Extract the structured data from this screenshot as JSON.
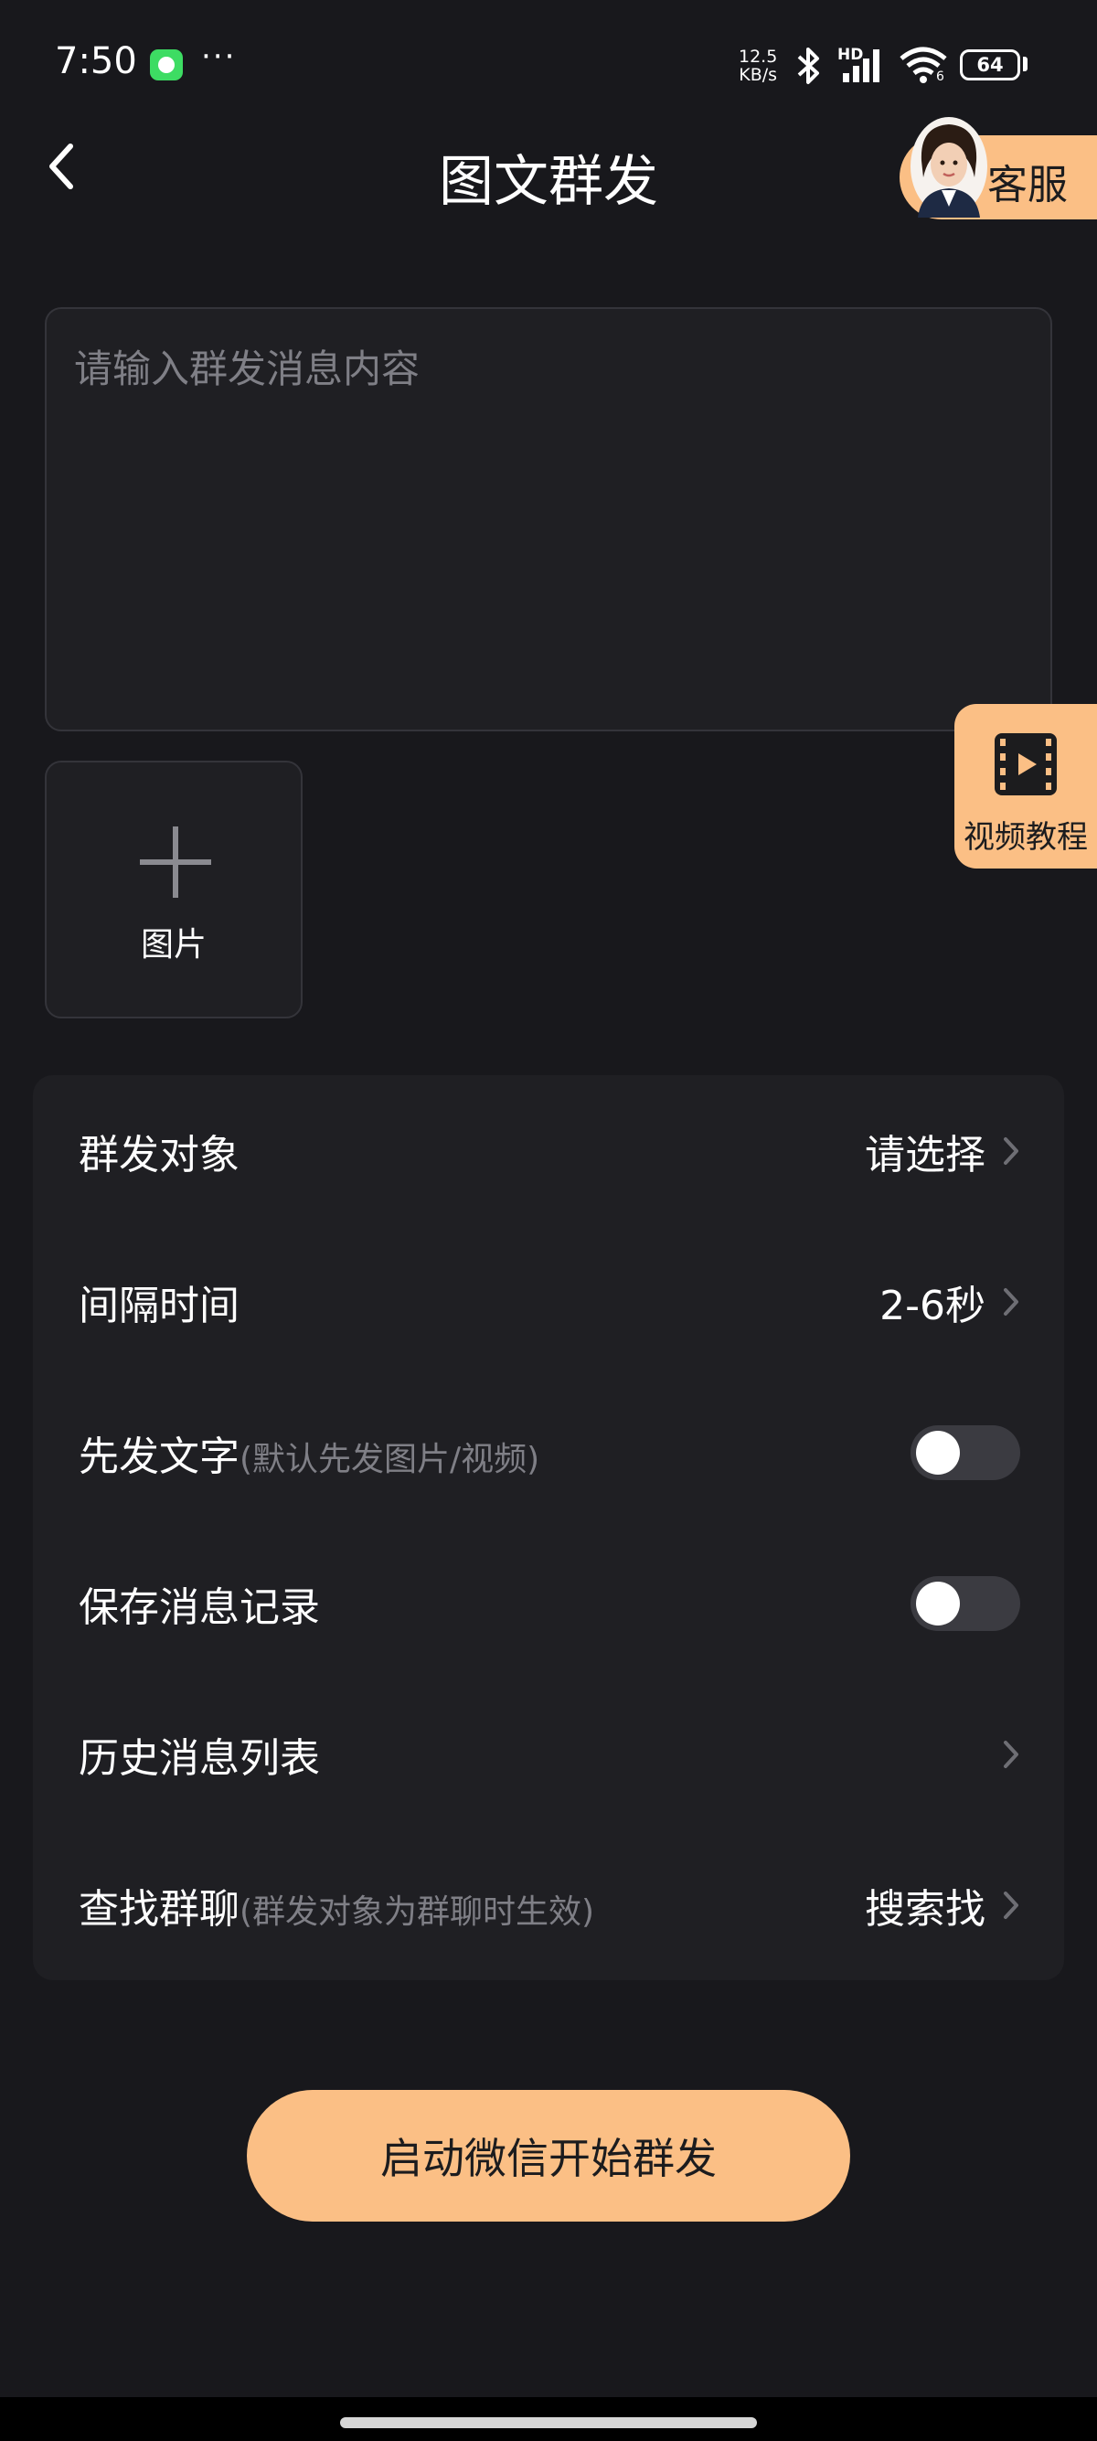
{
  "status_bar": {
    "time": "7:50",
    "more": "···",
    "net_speed_value": "12.5",
    "net_speed_unit": "KB/s",
    "hd_label": "HD",
    "wifi_sub": "6",
    "battery": "64"
  },
  "header": {
    "title": "图文群发",
    "service_label": "客服"
  },
  "message": {
    "placeholder": "请输入群发消息内容",
    "value": ""
  },
  "video_tutorial": {
    "label": "视频教程"
  },
  "add_image": {
    "label": "图片"
  },
  "settings": {
    "rows": [
      {
        "label": "群发对象",
        "hint": "",
        "value": "请选择",
        "control": "chevron"
      },
      {
        "label": "间隔时间",
        "hint": "",
        "value": "2-6秒",
        "control": "chevron"
      },
      {
        "label": "先发文字",
        "hint": "(默认先发图片/视频)",
        "value": "",
        "control": "toggle",
        "on": false
      },
      {
        "label": "保存消息记录",
        "hint": "",
        "value": "",
        "control": "toggle",
        "on": false
      },
      {
        "label": "历史消息列表",
        "hint": "",
        "value": "",
        "control": "chevron"
      },
      {
        "label": "查找群聊",
        "hint": "(群发对象为群聊时生效)",
        "value": "搜索找",
        "control": "chevron"
      }
    ]
  },
  "start_button": {
    "label": "启动微信开始群发"
  },
  "colors": {
    "background": "#18181c",
    "card": "#1f1f23",
    "accent": "#fbbf85",
    "muted_text": "#7f7f86"
  },
  "icons": [
    "back-arrow-icon",
    "bluetooth-icon",
    "signal-icon",
    "wifi-icon",
    "battery-icon",
    "video-play-icon",
    "plus-icon",
    "chevron-right-icon"
  ]
}
